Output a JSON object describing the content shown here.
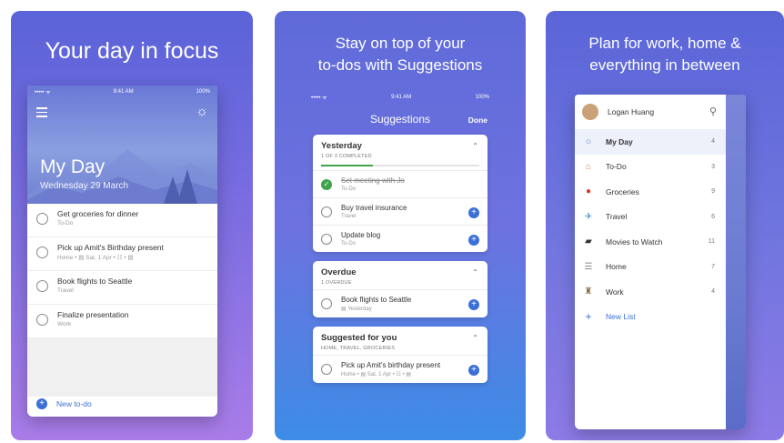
{
  "panel1": {
    "headline": "Your day in focus",
    "status": {
      "carrier": "••••• ᯤ",
      "time": "9:41 AM",
      "battery": "100%"
    },
    "title": "My Day",
    "date": "Wednesday 29 March",
    "todos": [
      {
        "title": "Get groceries for dinner",
        "meta": "To-Do"
      },
      {
        "title": "Pick up Amit's Birthday present",
        "meta": "Home • ▤ Sat, 1 Apr • ☷ • ▤"
      },
      {
        "title": "Book flights to Seattle",
        "meta": "Travel"
      },
      {
        "title": "Finalize presentation",
        "meta": "Work"
      }
    ],
    "new_todo": "New to-do"
  },
  "panel2": {
    "headline_line1": "Stay on top of your",
    "headline_line2": "to-dos with Suggestions",
    "status": {
      "carrier": "••••• ᯤ",
      "time": "9:41 AM",
      "battery": "100%"
    },
    "title": "Suggestions",
    "done": "Done",
    "yesterday": {
      "title": "Yesterday",
      "sub": "1 OF 3 COMPLETED",
      "progress": 0.33,
      "items": [
        {
          "title": "Set meeting with Jo",
          "meta": "To-Do"
        },
        {
          "title": "Buy travel insurance",
          "meta": "Travel"
        },
        {
          "title": "Update blog",
          "meta": "To-Do"
        }
      ]
    },
    "overdue": {
      "title": "Overdue",
      "sub": "1 OVERDUE",
      "items": [
        {
          "title": "Book flights to Seattle",
          "meta": "▤ Yesterday"
        }
      ]
    },
    "suggested": {
      "title": "Suggested for you",
      "sub": "HOME, TRAVEL, GROCERIES",
      "items": [
        {
          "title": "Pick up Amit's birthday present",
          "meta": "Home • ▤ Sat, 1 Apr • ☷ • ▤"
        }
      ]
    }
  },
  "panel3": {
    "headline_line1": "Plan for work, home &",
    "headline_line2": "everything in between",
    "user": "Logan Huang",
    "lists": [
      {
        "icon": "☼",
        "label": "My Day",
        "count": "4",
        "color": "#6b8fd8"
      },
      {
        "icon": "⌂",
        "label": "To-Do",
        "count": "3",
        "color": "#e0774a"
      },
      {
        "icon": "●",
        "label": "Groceries",
        "count": "9",
        "color": "#d63a2e"
      },
      {
        "icon": "✈",
        "label": "Travel",
        "count": "6",
        "color": "#4a8ad0"
      },
      {
        "icon": "▰",
        "label": "Movies to Watch",
        "count": "11",
        "color": "#333333"
      },
      {
        "icon": "☰",
        "label": "Home",
        "count": "7",
        "color": "#8a8a8a"
      },
      {
        "icon": "♜",
        "label": "Work",
        "count": "4",
        "color": "#8a6a4a"
      }
    ],
    "new_list": "New List"
  }
}
